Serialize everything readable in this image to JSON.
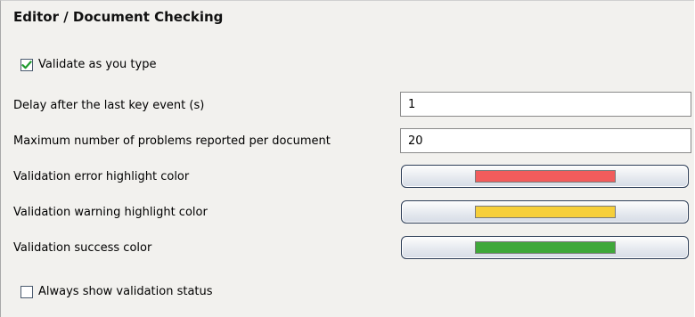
{
  "page_title": "Editor / Document Checking",
  "validate_as_you_type": {
    "label": "Validate as you type",
    "checked": true
  },
  "delay": {
    "label": "Delay after the last key event (s)",
    "value": "1"
  },
  "max_problems": {
    "label": "Maximum number of problems reported per document",
    "value": "20"
  },
  "error_color": {
    "label": "Validation error highlight color",
    "color": "#f25c5c"
  },
  "warning_color": {
    "label": "Validation warning highlight color",
    "color": "#f6cf3a"
  },
  "success_color": {
    "label": "Validation success color",
    "color": "#3fa83a"
  },
  "always_show_status": {
    "label": "Always show validation status",
    "checked": false
  }
}
